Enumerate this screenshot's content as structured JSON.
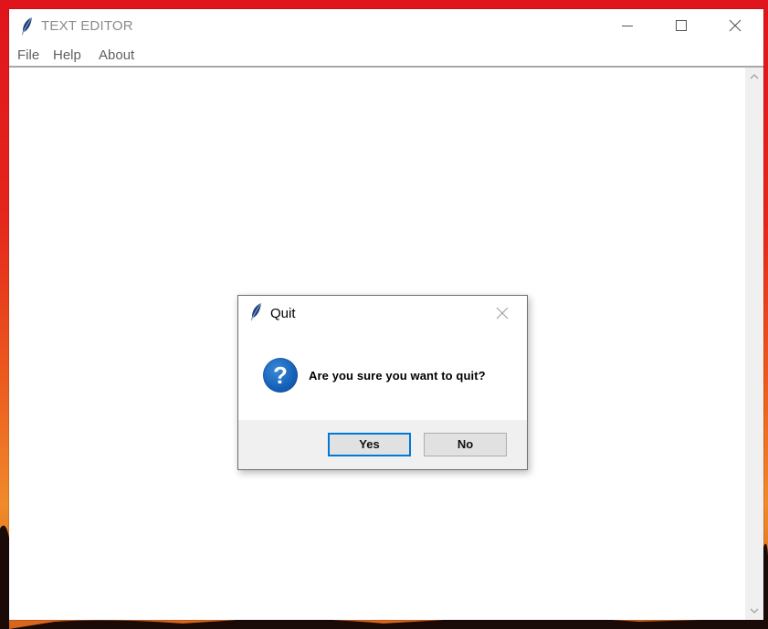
{
  "window": {
    "title": "TEXT EDITOR",
    "app_icon": "feather-icon",
    "controls": [
      "minimize-icon",
      "maximize-icon",
      "close-icon"
    ]
  },
  "menubar": {
    "items": [
      {
        "label": "File"
      },
      {
        "label": "Help"
      },
      {
        "label": "About"
      }
    ]
  },
  "editor": {
    "text": ""
  },
  "dialog": {
    "title": "Quit",
    "icon": "question-icon",
    "icon_glyph": "?",
    "message": "Are you sure you want to quit?",
    "buttons": {
      "yes": "Yes",
      "no": "No"
    },
    "default_button": "yes"
  },
  "colors": {
    "desktop_red": "#e0141c",
    "desktop_orange": "#f08a2a",
    "focus_blue": "#0078d7",
    "question_blue": "#1460b8"
  }
}
